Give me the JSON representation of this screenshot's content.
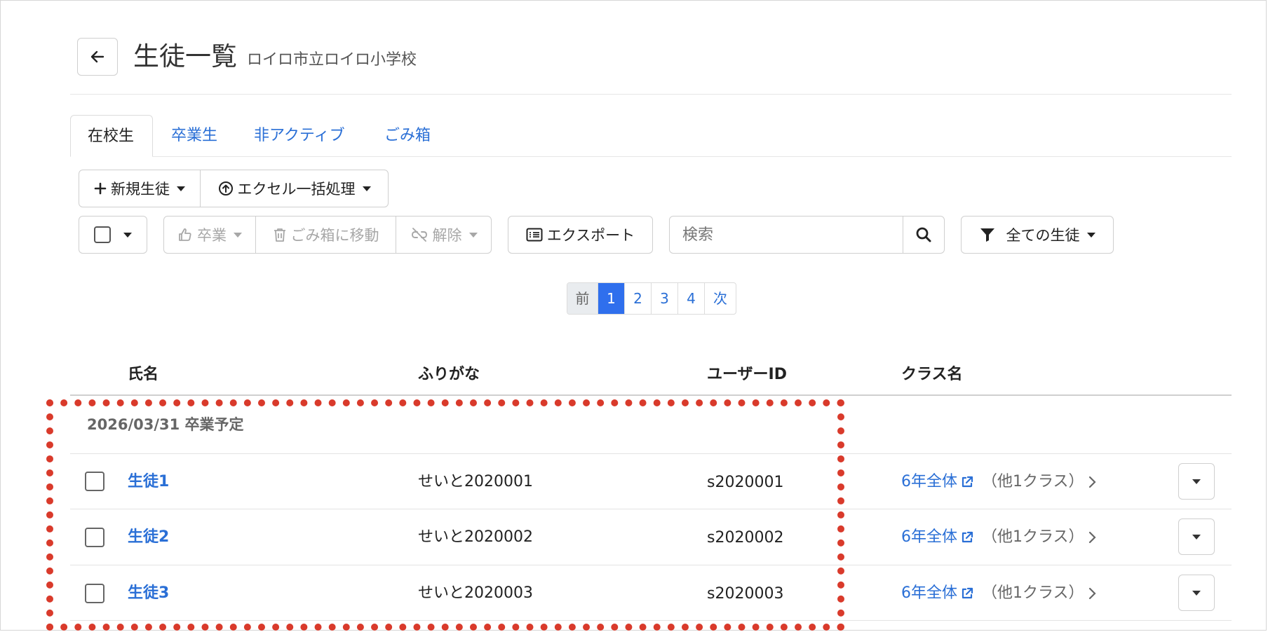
{
  "header": {
    "title": "生徒一覧",
    "subtitle": "ロイロ市立ロイロ小学校"
  },
  "tabs": [
    {
      "label": "在校生"
    },
    {
      "label": "卒業生"
    },
    {
      "label": "非アクティブ"
    },
    {
      "label": "ごみ箱"
    }
  ],
  "toolbar": {
    "new_student": "新規生徒",
    "excel_bulk": "エクセル一括処理",
    "graduate": "卒業",
    "move_to_trash": "ごみ箱に移動",
    "unlink": "解除",
    "export": "エクスポート",
    "search_placeholder": "検索",
    "filter": "全ての生徒"
  },
  "pagination": {
    "prev": "前",
    "pages": [
      "1",
      "2",
      "3",
      "4"
    ],
    "next": "次"
  },
  "table": {
    "headers": [
      "氏名",
      "ふりがな",
      "ユーザーID",
      "クラス名"
    ],
    "group_label": "2026/03/31 卒業予定",
    "rows": [
      {
        "name": "生徒1",
        "furigana": "せいと2020001",
        "user_id": "s2020001",
        "class": "6年全体",
        "other": "（他1クラス）"
      },
      {
        "name": "生徒2",
        "furigana": "せいと2020002",
        "user_id": "s2020002",
        "class": "6年全体",
        "other": "（他1クラス）"
      },
      {
        "name": "生徒3",
        "furigana": "せいと2020003",
        "user_id": "s2020003",
        "class": "6年全体",
        "other": "（他1クラス）"
      }
    ]
  },
  "colors": {
    "link": "#2a6fd6",
    "active_page": "#2f6fed",
    "highlight": "#d93a2b"
  }
}
